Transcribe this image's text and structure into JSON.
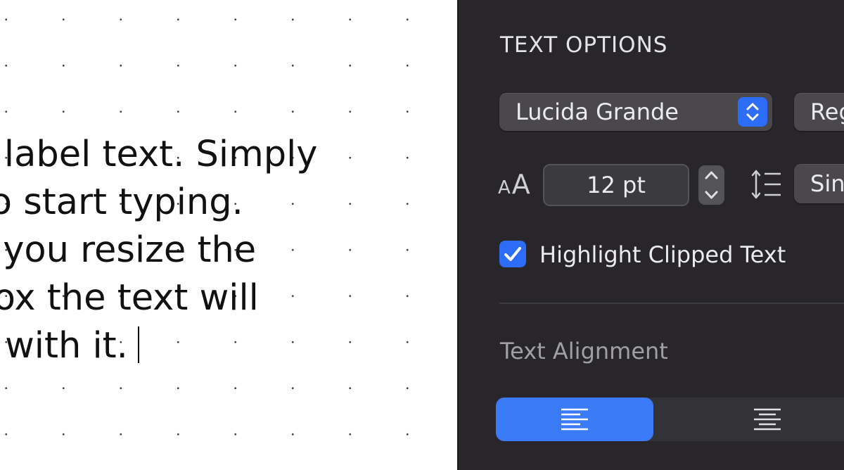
{
  "canvas": {
    "label_lines": [
      "is is label text. Simply",
      "ck to start typing.",
      "hen you resize the",
      "xt box the text will",
      "size with it."
    ]
  },
  "inspector": {
    "section_title": "TEXT OPTIONS",
    "font_family": "Lucida Grande",
    "font_style": "Reg",
    "text_size_icon": {
      "small": "A",
      "big": "A"
    },
    "font_size_value": "12 pt",
    "line_spacing": "Sin",
    "highlight_clipped": {
      "label": "Highlight Clipped Text",
      "checked": true
    },
    "alignment_title": "Text Alignment",
    "alignment_options": [
      {
        "name": "align-left",
        "selected": true
      },
      {
        "name": "align-center",
        "selected": false
      }
    ],
    "icons": [
      "chevron-updown-icon",
      "text-size-icon",
      "stepper-up-icon",
      "stepper-down-icon",
      "line-spacing-icon",
      "checkmark-icon",
      "align-left-icon",
      "align-center-icon"
    ]
  },
  "colors": {
    "panel_bg": "#28262a",
    "accent": "#2c6cf6",
    "segment_selected": "#3b7bf7",
    "control_bg": "#4a484c"
  }
}
